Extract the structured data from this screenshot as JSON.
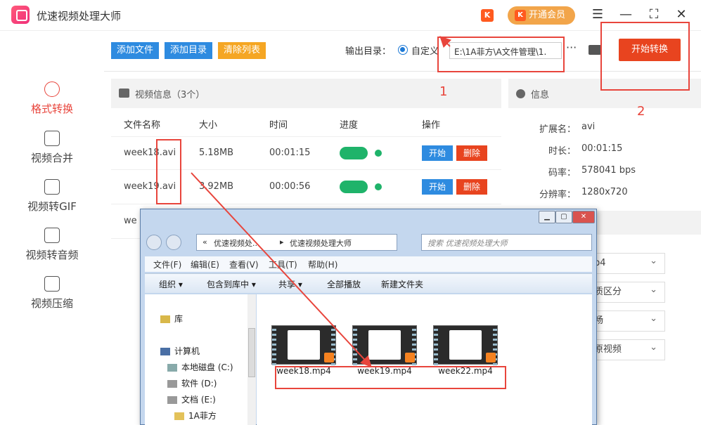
{
  "app": {
    "title": "优速视频处理大师",
    "vip_label": "开通会员",
    "k_icon": "K",
    "win_controls": {
      "menu": "☰",
      "minimize": "—",
      "maximize": "⛶",
      "close": "✕"
    }
  },
  "sidebar": {
    "items": [
      {
        "label": "格式转换",
        "icon": "convert-icon",
        "active": true
      },
      {
        "label": "视频合并",
        "icon": "merge-icon",
        "active": false
      },
      {
        "label": "视频转GIF",
        "icon": "gif-icon",
        "active": false
      },
      {
        "label": "视频转音频",
        "icon": "audio-icon",
        "active": false
      },
      {
        "label": "视频压缩",
        "icon": "compress-icon",
        "active": false
      }
    ]
  },
  "toolbar": {
    "add_file": "添加文件",
    "add_folder": "添加目录",
    "clear_list": "清除列表",
    "output_label": "输出目录：",
    "custom_label": "自定义",
    "output_path": "E:\\1A菲方\\A文件管理\\1.",
    "more": "···",
    "start": "开始转换"
  },
  "file_panel": {
    "title": "视频信息（3个）",
    "columns": [
      "文件名称",
      "大小",
      "时间",
      "进度",
      "操作"
    ],
    "rows": [
      {
        "name": "week18.avi",
        "size": "5.18MB",
        "time": "00:01:15",
        "start": "开始",
        "delete": "删除"
      },
      {
        "name": "week19.avi",
        "size": "3.92MB",
        "time": "00:00:56",
        "start": "开始",
        "delete": "删除"
      },
      {
        "name": "we",
        "size": "",
        "time": "",
        "start": "",
        "delete": ""
      }
    ]
  },
  "info_panel": {
    "title": "信息",
    "rows": [
      {
        "key": "扩展名：",
        "value": "avi"
      },
      {
        "key": "时长：",
        "value": "00:01:15"
      },
      {
        "key": "码率：",
        "value": "578041 bps"
      },
      {
        "key": "分辨率：",
        "value": "1280x720"
      }
    ],
    "selects": [
      "p4",
      "质区分",
      "畅",
      "原视频"
    ]
  },
  "explorer": {
    "breadcrumb": [
      "«",
      "优速视频处...",
      "▸",
      "优速视频处理大师"
    ],
    "search_placeholder": "搜索 优速视频处理大师",
    "menu": [
      "文件(F)",
      "编辑(E)",
      "查看(V)",
      "工具(T)",
      "帮助(H)"
    ],
    "commands": [
      "组织 ▾",
      "包含到库中 ▾",
      "共享 ▾",
      "全部播放",
      "新建文件夹"
    ],
    "nav": [
      "库",
      "计算机",
      "本地磁盘 (C:)",
      "软件 (D:)",
      "文档 (E:)",
      "1A菲方"
    ],
    "files": [
      {
        "name": "week18.mp4"
      },
      {
        "name": "week19.mp4"
      },
      {
        "name": "week22.mp4"
      }
    ]
  },
  "annotations": {
    "label1": "1",
    "label2": "2"
  },
  "colors": {
    "accent_red": "#e8453c",
    "blue_btn": "#2e8be0",
    "orange_btn": "#f5a623",
    "progress_green": "#1fb36a",
    "start_btn": "#e8441f"
  }
}
